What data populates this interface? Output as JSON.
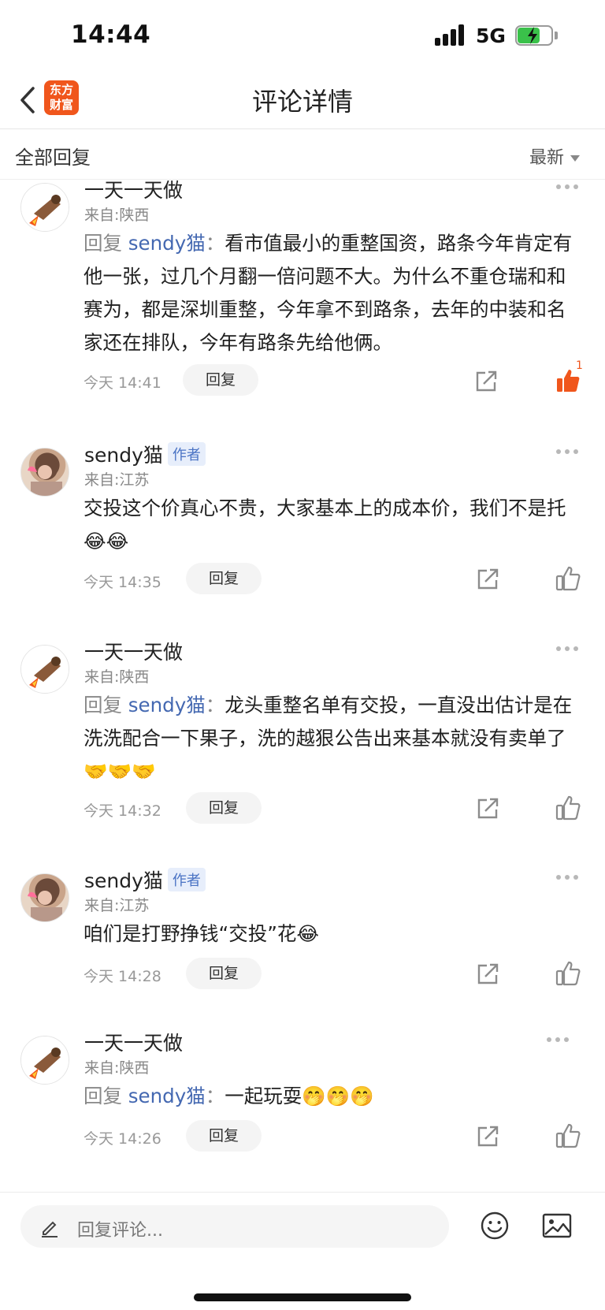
{
  "status_bar": {
    "time": "14:44",
    "network": "5G"
  },
  "nav": {
    "logo_line1": "东方",
    "logo_line2": "财富",
    "title": "评论详情"
  },
  "section": {
    "title": "全部回复",
    "sort_label": "最新"
  },
  "comments": [
    {
      "user": "一天一天做",
      "is_author": false,
      "location": "来自:陕西",
      "reply_prefix": "回复",
      "reply_to": "sendy猫",
      "separator": "：",
      "text": "看市值最小的重整国资，路条今年肯定有他一张，过几个月翻一倍问题不大。为什么不重仓瑞和和赛为，都是深圳重整，今年拿不到路条，去年的中装和名家还在排队，今年有路条先给他俩。",
      "time": "今天 14:41",
      "reply_label": "回复",
      "likes": "1",
      "liked": true
    },
    {
      "user": "sendy猫",
      "is_author": true,
      "author_tag": "作者",
      "location": "来自:江苏",
      "text": "交投这个价真心不贵，大家基本上的成本价，我们不是托😂😂",
      "time": "今天 14:35",
      "reply_label": "回复",
      "liked": false
    },
    {
      "user": "一天一天做",
      "is_author": false,
      "location": "来自:陕西",
      "reply_prefix": "回复",
      "reply_to": "sendy猫",
      "separator": "：",
      "text": "龙头重整名单有交投，一直没出估计是在洗洗配合一下果子，洗的越狠公告出来基本就没有卖单了🤝🤝🤝",
      "time": "今天 14:32",
      "reply_label": "回复",
      "liked": false
    },
    {
      "user": "sendy猫",
      "is_author": true,
      "author_tag": "作者",
      "location": "来自:江苏",
      "text": "咱们是打野挣钱“交投”花😂",
      "time": "今天 14:28",
      "reply_label": "回复",
      "liked": false
    },
    {
      "user": "一天一天做",
      "is_author": false,
      "location": "来自:陕西",
      "reply_prefix": "回复",
      "reply_to": "sendy猫",
      "separator": "：",
      "text": "一起玩耍🤭🤭🤭",
      "time": "今天 14:26",
      "reply_label": "回复",
      "liked": false
    }
  ],
  "bottom": {
    "placeholder": "回复评论..."
  },
  "colors": {
    "brand": "#f0561c",
    "link": "#4468b1",
    "author_tag_bg": "#e7eefb"
  },
  "icons": [
    "back-arrow-icon",
    "pencil-icon",
    "emoji-icon",
    "image-icon",
    "share-icon",
    "thumbs-up-icon",
    "more-dots-icon"
  ]
}
